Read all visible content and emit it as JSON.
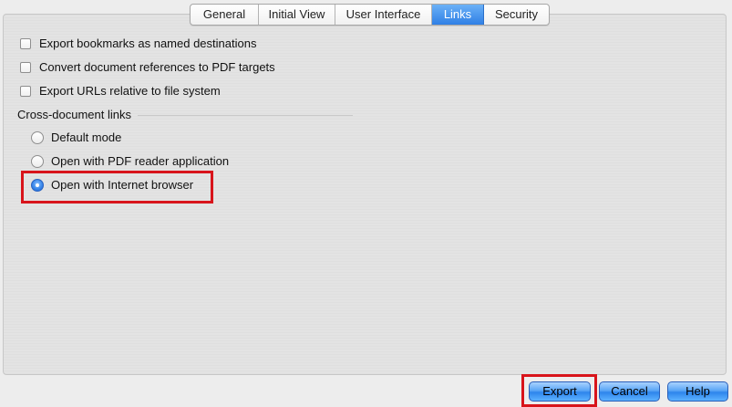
{
  "tabs": [
    {
      "label": "General",
      "active": false
    },
    {
      "label": "Initial View",
      "active": false
    },
    {
      "label": "User Interface",
      "active": false
    },
    {
      "label": "Links",
      "active": true
    },
    {
      "label": "Security",
      "active": false
    }
  ],
  "options": {
    "export_bookmarks": {
      "label": "Export bookmarks as named destinations",
      "checked": false
    },
    "convert_references": {
      "label": "Convert document references to PDF targets",
      "checked": false
    },
    "export_urls": {
      "label": "Export URLs relative to file system",
      "checked": false
    }
  },
  "cross_document": {
    "title": "Cross-document links",
    "options": [
      {
        "label": "Default mode",
        "selected": false
      },
      {
        "label": "Open with PDF reader application",
        "selected": false
      },
      {
        "label": "Open with Internet browser",
        "selected": true
      }
    ]
  },
  "buttons": {
    "export": "Export",
    "cancel": "Cancel",
    "help": "Help"
  },
  "colors": {
    "accent": "#2f7fe5",
    "highlight": "#d8141b"
  }
}
